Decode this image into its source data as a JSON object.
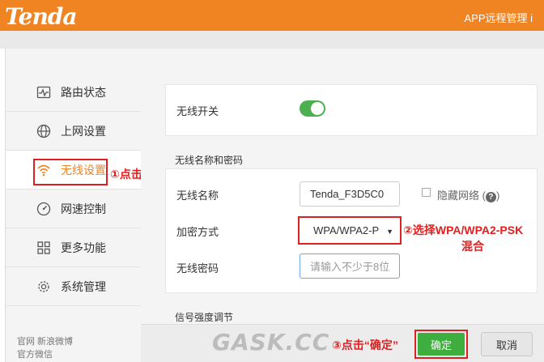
{
  "header": {
    "logo": "Tenda",
    "app_remote": "APP远程管理 i"
  },
  "sidebar": {
    "items": [
      {
        "label": "路由状态",
        "icon": "pulse-icon"
      },
      {
        "label": "上网设置",
        "icon": "globe-icon"
      },
      {
        "label": "无线设置",
        "icon": "wifi-icon",
        "active": true
      },
      {
        "label": "网速控制",
        "icon": "speedometer-icon"
      },
      {
        "label": "更多功能",
        "icon": "grid-icon"
      },
      {
        "label": "系统管理",
        "icon": "gear-icon"
      }
    ],
    "footer_links": {
      "line1": "官网  新浪微博",
      "line2": "官方微信"
    }
  },
  "annotations": {
    "step1": "①点击",
    "step2_line1": "②选择WPA/WPA2-PSK",
    "step2_line2": "混合",
    "step3": "③点击“确定”"
  },
  "wireless": {
    "switch_label": "无线开关",
    "switch_on": true,
    "section_title": "无线名称和密码",
    "ssid_label": "无线名称",
    "ssid_value": "Tenda_F3D5C0",
    "hide_network_label": "隐藏网络",
    "hide_network_checked": false,
    "encryption_label": "加密方式",
    "encryption_value": "WPA/WPA2-P",
    "password_label": "无线密码",
    "password_placeholder": "请输入不少于8位",
    "signal_section_title": "信号强度调节"
  },
  "footer": {
    "ok_label": "确定",
    "cancel_label": "取消"
  },
  "watermark": "GASK.CC",
  "colors": {
    "brand": "#f08423",
    "accent_green": "#3eae3e",
    "annotation_red": "#e02020"
  }
}
